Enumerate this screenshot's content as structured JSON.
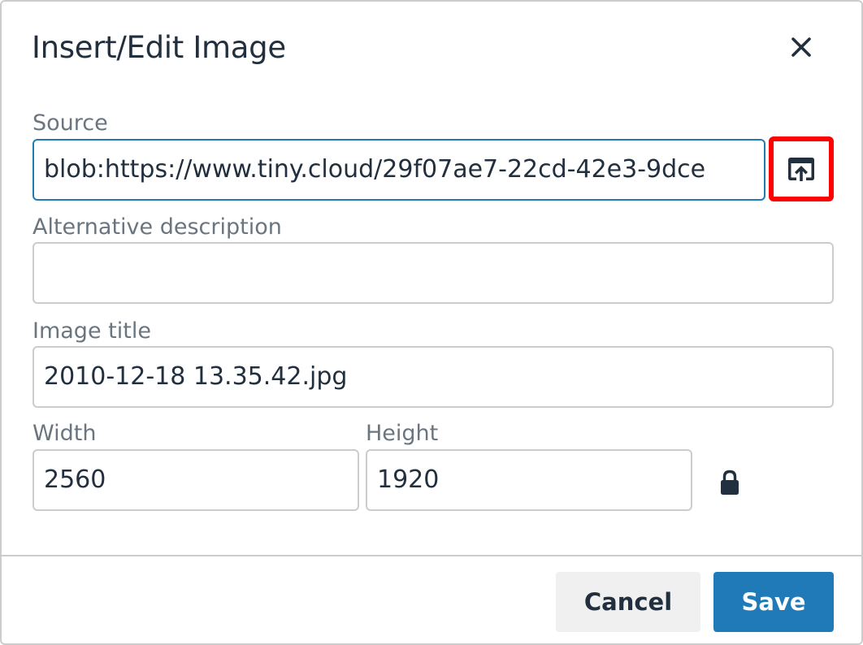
{
  "dialog": {
    "title": "Insert/Edit Image",
    "close_icon": "close-icon"
  },
  "source": {
    "label": "Source",
    "value": "blob:https://www.tiny.cloud/29f07ae7-22cd-42e3-9dce",
    "upload_icon": "upload-icon"
  },
  "alt": {
    "label": "Alternative description",
    "value": ""
  },
  "image_title": {
    "label": "Image title",
    "value": "2010-12-18 13.35.42.jpg"
  },
  "width": {
    "label": "Width",
    "value": "2560"
  },
  "height": {
    "label": "Height",
    "value": "1920"
  },
  "constrain": {
    "icon": "lock-icon"
  },
  "footer": {
    "cancel_label": "Cancel",
    "save_label": "Save"
  },
  "colors": {
    "primary": "#207ab7",
    "highlight": "#ff0000",
    "text": "#222f3e",
    "label": "#6a7580"
  }
}
